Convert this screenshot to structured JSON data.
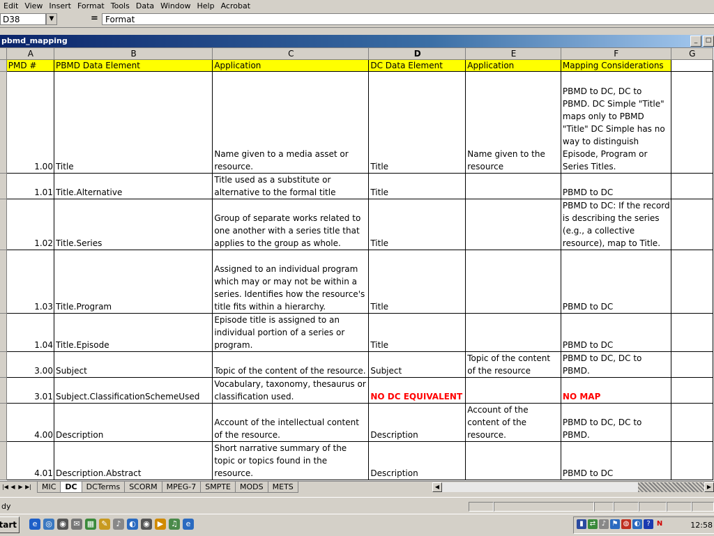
{
  "menu": [
    "Edit",
    "View",
    "Insert",
    "Format",
    "Tools",
    "Data",
    "Window",
    "Help",
    "Acrobat"
  ],
  "formula": {
    "cell_ref": "D38",
    "eq": "=",
    "content": "Format"
  },
  "window": {
    "title": "pbmd_mapping"
  },
  "columns": [
    "A",
    "B",
    "C",
    "D",
    "E",
    "F",
    "G"
  ],
  "header_row": [
    "PMD #",
    "PBMD Data Element",
    "Application",
    "DC Data Element",
    "Application",
    "Mapping Considerations",
    ""
  ],
  "rows": [
    {
      "a": "1.00",
      "b": "Title",
      "c": "Name given to a media asset or resource.",
      "d": "Title",
      "e": "Name given to the resource",
      "f": "PBMD to DC, DC to PBMD.  DC Simple \"Title\" maps only to PBMD \"Title\"  DC Simple has no way to distinguish Episode, Program or Series Titles."
    },
    {
      "a": "1.01",
      "b": "Title.Alternative",
      "c": "Title used as a substitute or alternative to the formal title",
      "d": "Title",
      "e": "",
      "f": "PBMD to DC"
    },
    {
      "a": "1.02",
      "b": "Title.Series",
      "c": "Group of separate works related to one another with a series title that applies to the group as whole.",
      "d": "Title",
      "e": "",
      "f": "PBMD to DC: If the record is describing the series (e.g., a collective resource), map to Title."
    },
    {
      "a": "1.03",
      "b": "Title.Program",
      "c": "Assigned to an individual program which may or may not be within a series. Identifies how the resource's title fits within a hierarchy.",
      "d": "Title",
      "e": "",
      "f": "PBMD to DC"
    },
    {
      "a": "1.04",
      "b": "Title.Episode",
      "c": "Episode title is assigned to an individual portion of a series or program.",
      "d": "Title",
      "e": "",
      "f": "PBMD to DC"
    },
    {
      "a": "3.00",
      "b": "Subject",
      "c": "Topic of the content of the resource.",
      "d": "Subject",
      "e": "Topic of the content of the resource",
      "f": "PBMD to DC, DC to PBMD."
    },
    {
      "a": "3.01",
      "b": "Subject.ClassificationSchemeUsed",
      "c": "Vocabulary, taxonomy, thesaurus or classification used.",
      "d": "NO DC EQUIVALENT",
      "e": "",
      "f": "NO MAP"
    },
    {
      "a": "4.00",
      "b": "Description",
      "c": "Account of the intellectual content of the resource.",
      "d": "Description",
      "e": "Account of the content of the resource.",
      "f": "PBMD to DC, DC to PBMD."
    },
    {
      "a": "4.01",
      "b": "Description.Abstract",
      "c": "Short narrative summary of the topic or topics found in the resource.",
      "d": "Description",
      "e": "",
      "f": "PBMD to DC"
    }
  ],
  "sheet_tabs": [
    "MIC",
    "DC",
    "DCTerms",
    "SCORM",
    "MPEG-7",
    "SMPTE",
    "MODS",
    "METS"
  ],
  "active_tab": "DC",
  "status": {
    "text": "dy"
  },
  "taskbar": {
    "start": "tart",
    "clock": "12:58"
  },
  "colors": {
    "header_fill": "#ffff00",
    "alert_text": "#ff0000",
    "title_bar": "#0a246a"
  }
}
